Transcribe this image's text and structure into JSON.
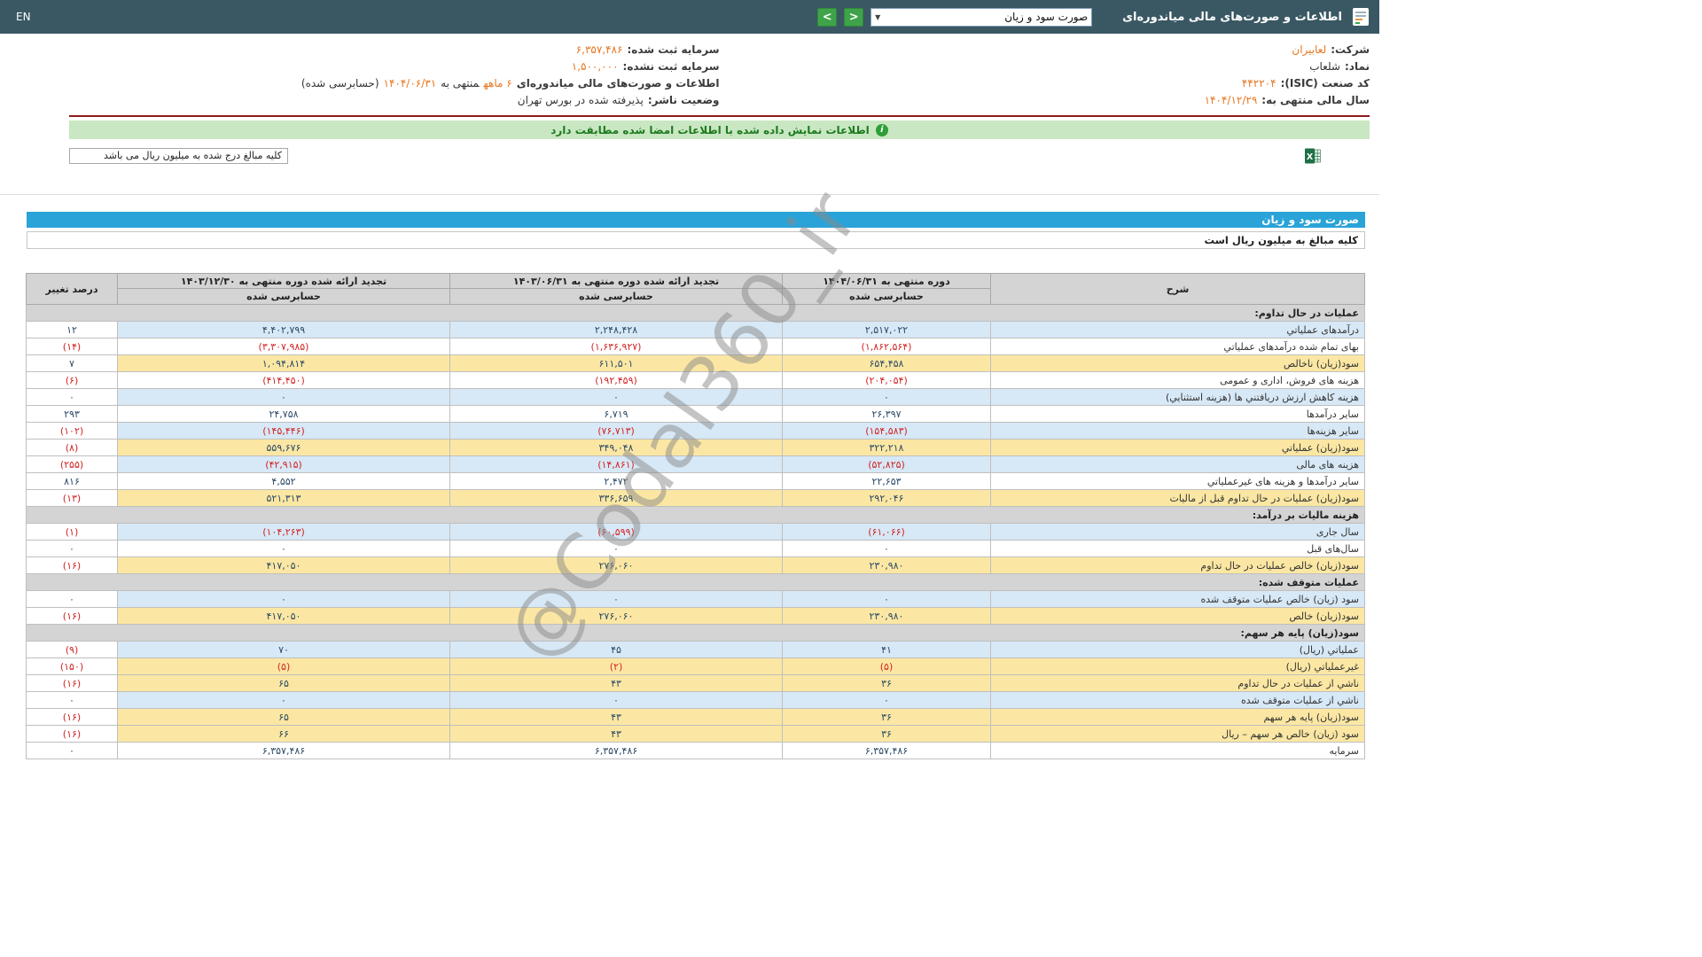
{
  "topbar": {
    "title": "اطلاعات و صورت‌های مالی میاندوره‌ای",
    "dropdown_value": "صورت سود و زیان",
    "nav_right_glyph": ">",
    "nav_left_glyph": "<",
    "language": "EN"
  },
  "company": {
    "right": [
      {
        "parts": [
          {
            "t": "شرکت:",
            "c": "lbl"
          },
          {
            "t": "لعابیران",
            "c": "link"
          }
        ]
      },
      {
        "parts": [
          {
            "t": "نماد:",
            "c": "lbl"
          },
          {
            "t": "شلعاب",
            "c": "dark"
          }
        ]
      },
      {
        "parts": [
          {
            "t": "کد صنعت (ISIC):",
            "c": "lbl"
          },
          {
            "t": "۴۴۲۲۰۴",
            "c": "orange"
          }
        ]
      },
      {
        "parts": [
          {
            "t": "سال مالی منتهی به:",
            "c": "lbl"
          },
          {
            "t": "۱۴۰۴/۱۲/۲۹",
            "c": "orange"
          }
        ]
      }
    ],
    "left": [
      {
        "parts": [
          {
            "t": "سرمایه ثبت شده:",
            "c": "lbl"
          },
          {
            "t": "۶,۳۵۷,۴۸۶",
            "c": "orange"
          }
        ]
      },
      {
        "parts": [
          {
            "t": "سرمایه ثبت نشده:",
            "c": "lbl"
          },
          {
            "t": "۱,۵۰۰,۰۰۰",
            "c": "orange"
          }
        ]
      },
      {
        "parts": [
          {
            "t": "اطلاعات و صورت‌های مالی میاندوره‌ای",
            "c": "lbl"
          },
          {
            "t": "۶ ماهه",
            "c": "orange"
          },
          {
            "t": "منتهی به",
            "c": "dark"
          },
          {
            "t": "۱۴۰۴/۰۶/۳۱",
            "c": "orange"
          },
          {
            "t": "(حسابرسی شده)",
            "c": "dark"
          }
        ]
      },
      {
        "parts": [
          {
            "t": "وضعیت ناشر:",
            "c": "lbl"
          },
          {
            "t": "پذیرفته شده در بورس تهران",
            "c": "dark"
          }
        ]
      }
    ]
  },
  "banner": {
    "text": "اطلاعات نمایش داده شده با اطلاعات امضا شده مطابقت دارد"
  },
  "export": {
    "note": "کلیه مبالغ درج شده به میلیون ریال می باشد"
  },
  "report": {
    "title": "صورت سود و زیان",
    "unit_note": "کلیه مبالغ به میلیون ریال است"
  },
  "table": {
    "header": {
      "desc": "شرح",
      "change": "درصد تغییر",
      "periods": [
        {
          "title": "دوره منتهی به ۱۴۰۴/۰۶/۳۱",
          "sub": "حسابرسی شده"
        },
        {
          "title": "تجدید ارائه شده دوره منتهی به ۱۴۰۳/۰۶/۳۱",
          "sub": "حسابرسی شده"
        },
        {
          "title": "تجدید ارائه شده دوره منتهی به ۱۴۰۳/۱۲/۳۰",
          "sub": "حسابرسی شده"
        }
      ]
    },
    "rows": [
      {
        "style": "section",
        "desc": "عملیات در حال تداوم:"
      },
      {
        "style": "blue",
        "desc": "درآمدهای عملیاتي",
        "values": [
          "۲,۵۱۷,۰۲۲",
          "۲,۲۴۸,۴۲۸",
          "۴,۴۰۲,۷۹۹"
        ],
        "change": "۱۲"
      },
      {
        "style": "white",
        "desc": "بهای تمام شده درآمدهای عملیاتي",
        "values": [
          "(۱,۸۶۲,۵۶۴)",
          "(۱,۶۳۶,۹۲۷)",
          "(۳,۳۰۷,۹۸۵)"
        ],
        "change": "(۱۴)"
      },
      {
        "style": "yellow",
        "desc": "سود(زیان) ناخالص",
        "values": [
          "۶۵۴,۴۵۸",
          "۶۱۱,۵۰۱",
          "۱,۰۹۴,۸۱۴"
        ],
        "change": "۷"
      },
      {
        "style": "white",
        "desc": "هزینه های فروش، اداری و عمومی",
        "values": [
          "(۲۰۴,۰۵۴)",
          "(۱۹۲,۴۵۹)",
          "(۴۱۴,۴۵۰)"
        ],
        "change": "(۶)"
      },
      {
        "style": "blue",
        "desc": "هزینه کاهش ارزش دریافتني ها (هزینه استثنایي)",
        "values": [
          "۰",
          "۰",
          "۰"
        ],
        "change": "۰"
      },
      {
        "style": "white",
        "desc": "سایر درآمدها",
        "values": [
          "۲۶,۳۹۷",
          "۶,۷۱۹",
          "۲۴,۷۵۸"
        ],
        "change": "۲۹۳"
      },
      {
        "style": "blue",
        "desc": "سایر هزینه‌ها",
        "values": [
          "(۱۵۴,۵۸۳)",
          "(۷۶,۷۱۳)",
          "(۱۴۵,۴۴۶)"
        ],
        "change": "(۱۰۲)"
      },
      {
        "style": "yellow",
        "desc": "سود(زیان) عملیاتي",
        "values": [
          "۳۲۲,۲۱۸",
          "۳۴۹,۰۴۸",
          "۵۵۹,۶۷۶"
        ],
        "change": "(۸)"
      },
      {
        "style": "blue",
        "desc": "هزینه های مالی",
        "values": [
          "(۵۲,۸۲۵)",
          "(۱۴,۸۶۱)",
          "(۴۲,۹۱۵)"
        ],
        "change": "(۲۵۵)"
      },
      {
        "style": "white",
        "desc": "سایر درآمدها و هزینه های غیرعملیاتي",
        "values": [
          "۲۲,۶۵۳",
          "۲,۴۷۲",
          "۴,۵۵۲"
        ],
        "change": "۸۱۶"
      },
      {
        "style": "yellow",
        "desc": "سود(زیان) عملیات در حال تداوم قبل از مالیات",
        "values": [
          "۲۹۲,۰۴۶",
          "۳۳۶,۶۵۹",
          "۵۲۱,۳۱۳"
        ],
        "change": "(۱۳)"
      },
      {
        "style": "section",
        "desc": "هزینه مالیات بر درآمد:"
      },
      {
        "style": "blue",
        "desc": "سال جاری",
        "values": [
          "(۶۱,۰۶۶)",
          "(۶۰,۵۹۹)",
          "(۱۰۴,۲۶۳)"
        ],
        "change": "(۱)"
      },
      {
        "style": "white",
        "desc": "سال‌های قبل",
        "values": [
          "۰",
          "۰",
          "۰"
        ],
        "change": "۰"
      },
      {
        "style": "yellow",
        "desc": "سود(زیان) خالص عملیات در حال تداوم",
        "values": [
          "۲۳۰,۹۸۰",
          "۲۷۶,۰۶۰",
          "۴۱۷,۰۵۰"
        ],
        "change": "(۱۶)"
      },
      {
        "style": "section",
        "desc": "عملیات متوقف شده:"
      },
      {
        "style": "blue",
        "desc": "سود (زیان) خالص عملیات متوقف شده",
        "values": [
          "۰",
          "۰",
          "۰"
        ],
        "change": "۰"
      },
      {
        "style": "yellow",
        "desc": "سود(زیان) خالص",
        "values": [
          "۲۳۰,۹۸۰",
          "۲۷۶,۰۶۰",
          "۴۱۷,۰۵۰"
        ],
        "change": "(۱۶)"
      },
      {
        "style": "section",
        "desc": "سود(زیان) پایه هر سهم:"
      },
      {
        "style": "blue",
        "desc": "عملیاتي (ریال)",
        "values": [
          "۴۱",
          "۴۵",
          "۷۰"
        ],
        "change": "(۹)"
      },
      {
        "style": "yellow",
        "desc": "غیرعملیاتي (ریال)",
        "values": [
          "(۵)",
          "(۲)",
          "(۵)"
        ],
        "change": "(۱۵۰)"
      },
      {
        "style": "yellow",
        "desc": "ناشي از عملیات در حال تداوم",
        "values": [
          "۳۶",
          "۴۳",
          "۶۵"
        ],
        "change": "(۱۶)"
      },
      {
        "style": "blue",
        "desc": "ناشي از عملیات متوقف شده",
        "values": [
          "۰",
          "۰",
          "۰"
        ],
        "change": "۰"
      },
      {
        "style": "yellow",
        "desc": "سود(زیان) پایه هر سهم",
        "values": [
          "۳۶",
          "۴۳",
          "۶۵"
        ],
        "change": "(۱۶)"
      },
      {
        "style": "yellow",
        "desc": "سود (زیان) خالص هر سهم – ریال",
        "values": [
          "۳۶",
          "۴۳",
          "۶۶"
        ],
        "change": "(۱۶)"
      },
      {
        "style": "white",
        "desc": "سرمایه",
        "values": [
          "۶,۳۵۷,۴۸۶",
          "۶,۳۵۷,۴۸۶",
          "۶,۳۵۷,۴۸۶"
        ],
        "change": "۰"
      }
    ]
  },
  "watermark": {
    "text": "@Codal360_ir"
  },
  "colors": {
    "topbar": "#3a5864",
    "accent-blue": "#29a3d8",
    "row-blue": "#d7e8f6",
    "row-yellow": "#fbe7a3",
    "negative": "#d32424",
    "positive": "#2c4a66",
    "orange-value": "#e87722",
    "banner-green": "#c9e7c2",
    "nav-green": "#3fa34a"
  }
}
